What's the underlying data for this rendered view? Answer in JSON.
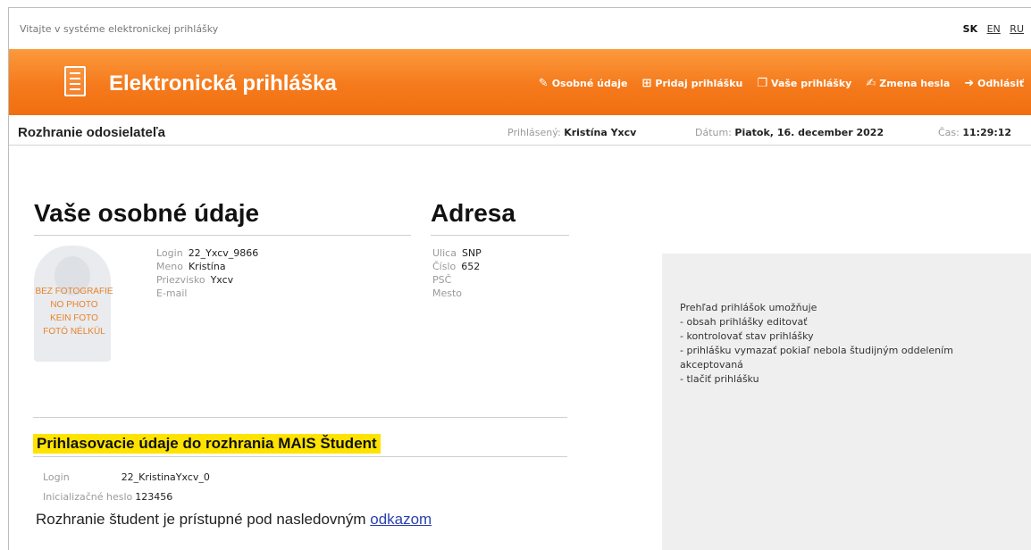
{
  "header": {
    "welcome": "Vitajte v systéme elektronickej prihlášky",
    "languages": [
      {
        "label": "SK",
        "active": true
      },
      {
        "label": "EN",
        "active": false
      },
      {
        "label": "RU",
        "active": false
      }
    ]
  },
  "banner": {
    "title": "Elektronická prihláška",
    "nav": [
      {
        "label": "Osobné údaje",
        "icon": "edit-icon"
      },
      {
        "label": "Pridaj prihlášku",
        "icon": "add-document-icon"
      },
      {
        "label": "Vaše prihlášky",
        "icon": "documents-icon"
      },
      {
        "label": "Zmena hesla",
        "icon": "key-edit-icon"
      },
      {
        "label": "Odhlásiť",
        "icon": "logout-icon"
      }
    ]
  },
  "subbar": {
    "title": "Rozhranie odosielateľa",
    "logged_label": "Prihlásený:",
    "logged_user": "Kristína Yxcv",
    "date_label": "Dátum:",
    "date_value": "Piatok, 16. december 2022",
    "time_label": "Čas:",
    "time_value": "11:29:12"
  },
  "personal": {
    "heading": "Vaše osobné údaje",
    "photo_placeholder": [
      "BEZ FOTOGRAFIE",
      "NO PHOTO",
      "KEIN FOTO",
      "FOTÓ NÉLKÜL"
    ],
    "fields": [
      {
        "label": "Login",
        "value": "22_Yxcv_9866"
      },
      {
        "label": "Meno",
        "value": "Kristína"
      },
      {
        "label": "Priezvisko",
        "value": "Yxcv"
      },
      {
        "label": "E-mail",
        "value": ""
      }
    ]
  },
  "address": {
    "heading": "Adresa",
    "fields": [
      {
        "label": "Ulica",
        "value": "SNP"
      },
      {
        "label": "Číslo",
        "value": "652"
      },
      {
        "label": "PSČ",
        "value": ""
      },
      {
        "label": "Mesto",
        "value": ""
      }
    ]
  },
  "info": {
    "lines": [
      "Prehľad prihlášok umožňuje",
      "- obsah prihlášky editovať",
      "- kontrolovať stav prihlášky",
      "- prihlášku vymazať pokiaľ nebola študijným oddelením akceptovaná",
      "- tlačiť prihlášku"
    ]
  },
  "mais": {
    "heading": "Prihlasovacie údaje do rozhrania MAIS Študent",
    "login_label": "Login",
    "login_value": "22_KristinaYxcv_0",
    "password_label": "Inicializačné heslo",
    "password_value": "123456",
    "footer_text": "Rozhranie študent je prístupné pod nasledovným ",
    "footer_link": "odkazom"
  },
  "colors": {
    "banner_orange": "#f57a1c",
    "highlight_yellow": "#ffe300",
    "link_blue": "#2a3fb0"
  }
}
